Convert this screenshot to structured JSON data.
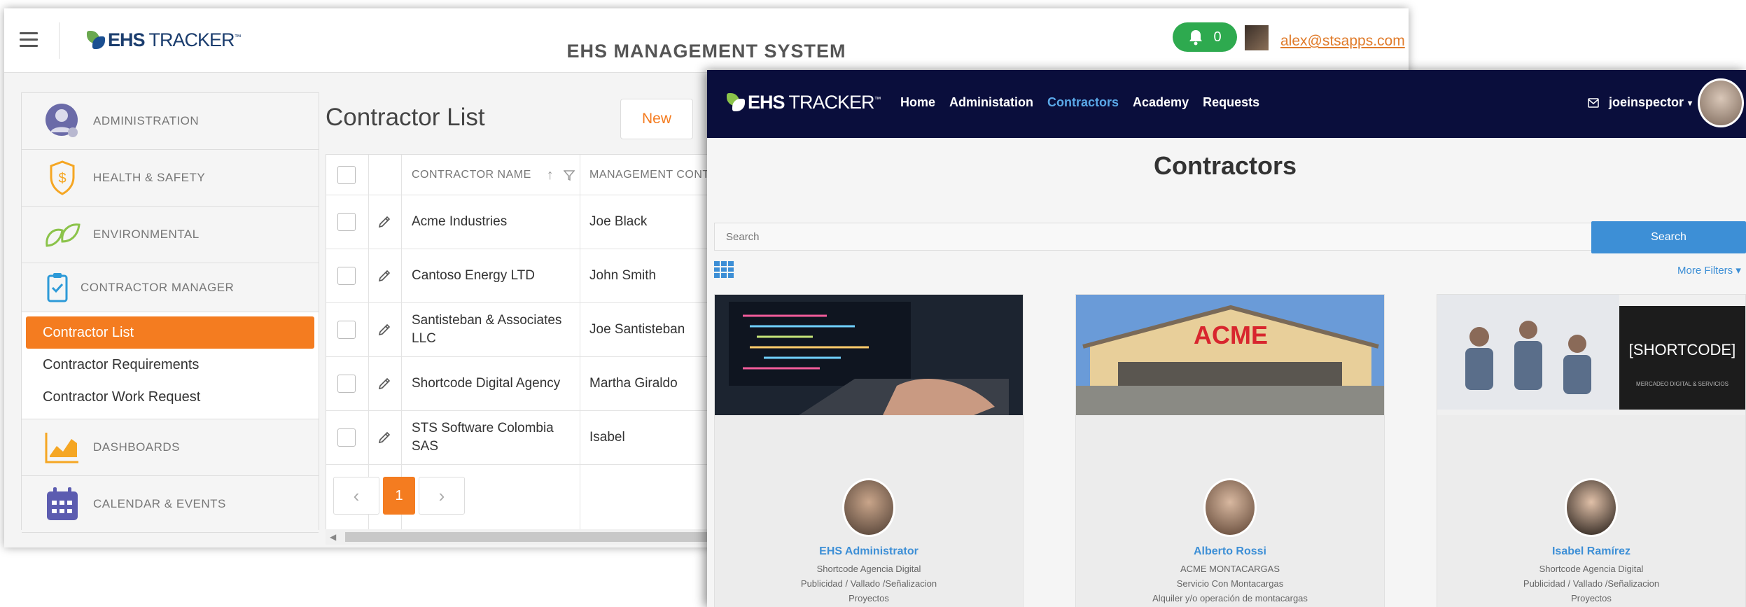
{
  "back_window": {
    "app_title": "EHS MANAGEMENT SYSTEM",
    "logo": {
      "bold": "EHS",
      "rest": " TRACKER",
      "tm": "™"
    },
    "notifications": {
      "count": "0"
    },
    "user_email": "alex@stsapps.com",
    "sidebar": {
      "sections": [
        {
          "label": "ADMINISTRATION",
          "icon": "admin-user-icon"
        },
        {
          "label": "HEALTH & SAFETY",
          "icon": "shield-dollar-icon"
        },
        {
          "label": "ENVIRONMENTAL",
          "icon": "leaf-icon"
        },
        {
          "label": "CONTRACTOR MANAGER",
          "icon": "clipboard-icon"
        }
      ],
      "sub_items": [
        "Contractor List",
        "Contractor Requirements",
        "Contractor Work Request"
      ],
      "active_sub_item": "Contractor List",
      "sections_after": [
        {
          "label": "DASHBOARDS",
          "icon": "chart-icon"
        },
        {
          "label": "CALENDAR & EVENTS",
          "icon": "calendar-icon"
        }
      ]
    },
    "page_title": "Contractor List",
    "new_button": "New",
    "table": {
      "columns": [
        "CONTRACTOR NAME",
        "MANAGEMENT CONTACT"
      ],
      "rows": [
        {
          "name": "Acme Industries",
          "contact": "Joe Black"
        },
        {
          "name": "Cantoso Energy LTD",
          "contact": "John Smith"
        },
        {
          "name": "Santisteban & Associates LLC",
          "contact": "Joe Santisteban"
        },
        {
          "name": "Shortcode Digital Agency",
          "contact": "Martha Giraldo"
        },
        {
          "name": "STS Software Colombia SAS",
          "contact": "Isabel"
        }
      ]
    },
    "pager": {
      "prev": "‹",
      "current": "1",
      "next": "›"
    }
  },
  "front_window": {
    "logo": {
      "bold": "EHS",
      "rest": " TRACKER",
      "tm": "™"
    },
    "nav": [
      "Home",
      "Administation",
      "Contractors",
      "Academy",
      "Requests"
    ],
    "active_nav": "Contractors",
    "username": "joeinspector",
    "title": "Contractors",
    "search": {
      "placeholder": "Search",
      "button": "Search"
    },
    "more_filters": "More Filters ▾",
    "cards": [
      {
        "name": "EHS Administrator",
        "lines": [
          "Shortcode Agencia Digital",
          "Publicidad / Vallado /Señalizacion",
          "Proyectos"
        ]
      },
      {
        "name": "Alberto Rossi",
        "banner_text": "ACME",
        "lines": [
          "ACME MONTACARGAS",
          "Servicio Con Montacargas",
          "Alquiler y/o operación de montacargas"
        ]
      },
      {
        "name": "Isabel Ramírez",
        "banner_text": "[SHORTCODE]",
        "banner_subtext": "MERCADEO DIGITAL & SERVICIOS",
        "lines": [
          "Shortcode Agencia Digital",
          "Publicidad / Vallado /Señalizacion",
          "Proyectos"
        ]
      }
    ]
  },
  "colors": {
    "accent_orange": "#f47c20",
    "nav_dark": "#0a0e3c",
    "link_blue": "#3d8fd6",
    "notif_green": "#2eaa4f"
  }
}
